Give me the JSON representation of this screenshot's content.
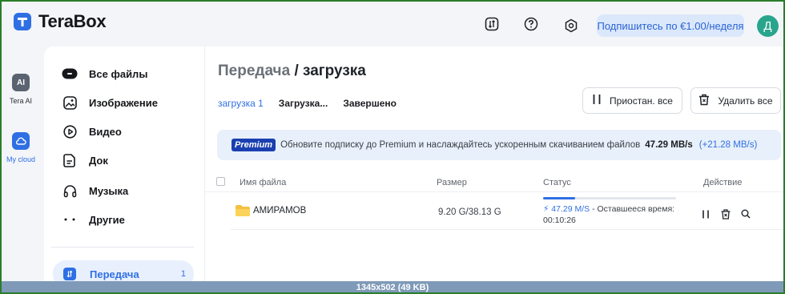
{
  "app": {
    "name": "TeraBox"
  },
  "header": {
    "subscribe_label": "Подпишитесь по €1.00/неделя",
    "avatar_letter": "Д"
  },
  "rail": {
    "items": [
      {
        "label": "Tera AI",
        "icon": "tera-ai-icon"
      },
      {
        "label": "My cloud",
        "icon": "cloud-icon"
      }
    ]
  },
  "sidebar": {
    "items": [
      {
        "label": "Все файлы",
        "icon": "all-files-icon"
      },
      {
        "label": "Изображение",
        "icon": "image-icon"
      },
      {
        "label": "Видео",
        "icon": "video-icon"
      },
      {
        "label": "Док",
        "icon": "document-icon"
      },
      {
        "label": "Музыка",
        "icon": "headphones-icon"
      },
      {
        "label": "Другие",
        "icon": "more-dots-icon"
      }
    ],
    "transfer": {
      "label": "Передача",
      "count": "1"
    }
  },
  "main": {
    "title_crumb": "Передача",
    "title_sep": "/",
    "title_current": "загрузка",
    "tabs": [
      {
        "label": "загрузка 1",
        "active": true
      },
      {
        "label": "Загрузка...",
        "active": false
      },
      {
        "label": "Завершено",
        "active": false
      }
    ],
    "pause_all_label": "Приостан. все",
    "delete_all_label": "Удалить все",
    "banner": {
      "badge": "Premium",
      "text": "Обновите подписку до Premium и наслаждайтесь ускоренным скачиванием файлов",
      "speed": "47.29 MB/s",
      "boost": "(+21.28 MB/s)"
    },
    "table": {
      "columns": [
        "Имя файла",
        "Размер",
        "Статус",
        "Действие"
      ],
      "rows": [
        {
          "name": "АМИРАМОВ",
          "size": "9.20 G/38.13 G",
          "progress": 0.24,
          "speed": "47.29 M/S",
          "remaining_label": "- Оставшееся время:",
          "remaining_time": "00:10:26"
        }
      ]
    }
  },
  "watermark": "1345x502 (49 KB)",
  "colors": {
    "accent": "#2f6fe4",
    "avatar": "#2aa58d",
    "premium_badge": "#1a3fb0"
  }
}
